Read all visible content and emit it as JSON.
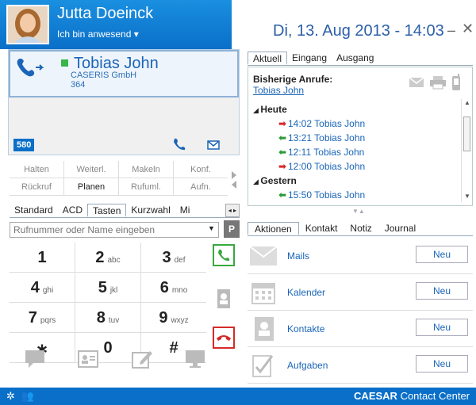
{
  "header": {
    "user_name": "Jutta Doeinck",
    "presence": "Ich bin anwesend",
    "datetime": "Di, 13. Aug 2013 - 14:03",
    "min": "–",
    "close": "✕"
  },
  "call": {
    "name": "Tobias John",
    "company": "CASERIS GmbH",
    "extension": "364",
    "line": "580"
  },
  "call_actions": [
    [
      {
        "label": "Halten",
        "on": false
      },
      {
        "label": "Weiterl.",
        "on": false
      },
      {
        "label": "Makeln",
        "on": false
      },
      {
        "label": "Konf.",
        "on": false
      }
    ],
    [
      {
        "label": "Rückruf",
        "on": false
      },
      {
        "label": "Planen",
        "on": true
      },
      {
        "label": "Rufuml.",
        "on": false
      },
      {
        "label": "Aufn.",
        "on": false
      }
    ]
  ],
  "left_tabs": [
    {
      "label": "Standard",
      "on": false
    },
    {
      "label": "ACD",
      "on": false
    },
    {
      "label": "Tasten",
      "on": true
    },
    {
      "label": "Kurzwahl",
      "on": false
    },
    {
      "label": "Mi",
      "on": false
    }
  ],
  "dial": {
    "placeholder": "Rufnummer oder Name eingeben",
    "park": "P"
  },
  "keypad": [
    [
      {
        "d": "1",
        "s": ""
      },
      {
        "d": "2",
        "s": "abc"
      },
      {
        "d": "3",
        "s": "def"
      }
    ],
    [
      {
        "d": "4",
        "s": "ghi"
      },
      {
        "d": "5",
        "s": "jkl"
      },
      {
        "d": "6",
        "s": "mno"
      }
    ],
    [
      {
        "d": "7",
        "s": "pqrs"
      },
      {
        "d": "8",
        "s": "tuv"
      },
      {
        "d": "9",
        "s": "wxyz"
      }
    ],
    [
      {
        "d": "∗",
        "s": ""
      },
      {
        "d": "0",
        "s": ""
      },
      {
        "d": "#",
        "s": ""
      }
    ]
  ],
  "right_tabs": [
    {
      "label": "Aktuell",
      "on": true
    },
    {
      "label": "Eingang",
      "on": false
    },
    {
      "label": "Ausgang",
      "on": false
    }
  ],
  "history": {
    "title": "Bisherige Anrufe:",
    "contact": "Tobias John",
    "groups": [
      {
        "label": "Heute",
        "calls": [
          {
            "dir": "out",
            "time": "14:02",
            "name": "Tobias John"
          },
          {
            "dir": "in",
            "time": "13:21",
            "name": "Tobias John"
          },
          {
            "dir": "in",
            "time": "12:11",
            "name": "Tobias John"
          },
          {
            "dir": "out",
            "time": "12:00",
            "name": "Tobias John"
          }
        ]
      },
      {
        "label": "Gestern",
        "calls": [
          {
            "dir": "in",
            "time": "15:50",
            "name": "Tobias John"
          }
        ]
      }
    ]
  },
  "info_tabs": [
    {
      "label": "Aktionen",
      "on": true
    },
    {
      "label": "Kontakt",
      "on": false
    },
    {
      "label": "Notiz",
      "on": false
    },
    {
      "label": "Journal",
      "on": false
    }
  ],
  "info_rows": [
    {
      "label": "Mails",
      "button": "Neu",
      "icon": "mail-icon"
    },
    {
      "label": "Kalender",
      "button": "Neu",
      "icon": "calendar-icon"
    },
    {
      "label": "Kontakte",
      "button": "Neu",
      "icon": "contact-icon"
    },
    {
      "label": "Aufgaben",
      "button": "Neu",
      "icon": "task-icon"
    }
  ],
  "footer": {
    "brand_bold": "CAESAR",
    "brand_rest": " Contact Center"
  }
}
